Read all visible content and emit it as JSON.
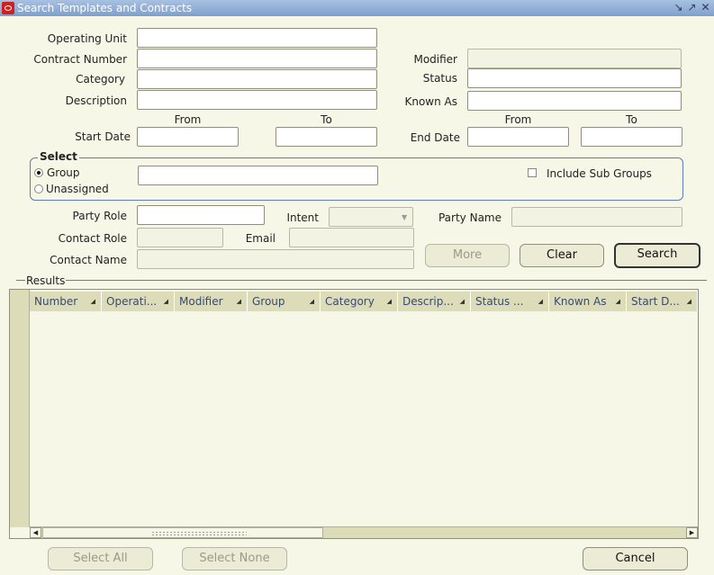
{
  "window": {
    "title": "Search Templates and Contracts"
  },
  "form": {
    "operating_unit": {
      "label": "Operating Unit",
      "value": ""
    },
    "contract_number": {
      "label": "Contract Number",
      "value": ""
    },
    "category": {
      "label": "Category",
      "value": ""
    },
    "description": {
      "label": "Description",
      "value": ""
    },
    "modifier": {
      "label": "Modifier",
      "value": ""
    },
    "status": {
      "label": "Status",
      "value": ""
    },
    "known_as": {
      "label": "Known As",
      "value": ""
    },
    "from_label": "From",
    "to_label": "To",
    "start_date": {
      "label": "Start Date",
      "from": "",
      "to": ""
    },
    "end_date": {
      "label": "End Date",
      "from": "",
      "to": ""
    },
    "select": {
      "legend": "Select",
      "group_label": "Group",
      "unassigned_label": "Unassigned",
      "selected": "Group",
      "group_value": "",
      "include_sub_groups_label": "Include Sub Groups",
      "include_sub_groups_checked": false
    },
    "party_role": {
      "label": "Party Role",
      "value": ""
    },
    "intent": {
      "label": "Intent",
      "value": ""
    },
    "party_name": {
      "label": "Party Name",
      "value": ""
    },
    "contact_role": {
      "label": "Contact Role",
      "value": ""
    },
    "email": {
      "label": "Email",
      "value": ""
    },
    "contact_name": {
      "label": "Contact Name",
      "value": ""
    }
  },
  "buttons": {
    "more": "More",
    "clear": "Clear",
    "search": "Search",
    "select_all": "Select All",
    "select_none": "Select None",
    "cancel": "Cancel"
  },
  "results": {
    "label": "Results",
    "columns": [
      "Number",
      "Operati...",
      "Modifier",
      "Group",
      "Category",
      "Descrip...",
      "Status ...",
      "Known As",
      "Start D..."
    ],
    "rows": []
  },
  "colors": {
    "background": "#f7f7e7",
    "titlebar": "#8ba9d4",
    "accent": "#5d7db4",
    "header": "#dcdcb8"
  }
}
